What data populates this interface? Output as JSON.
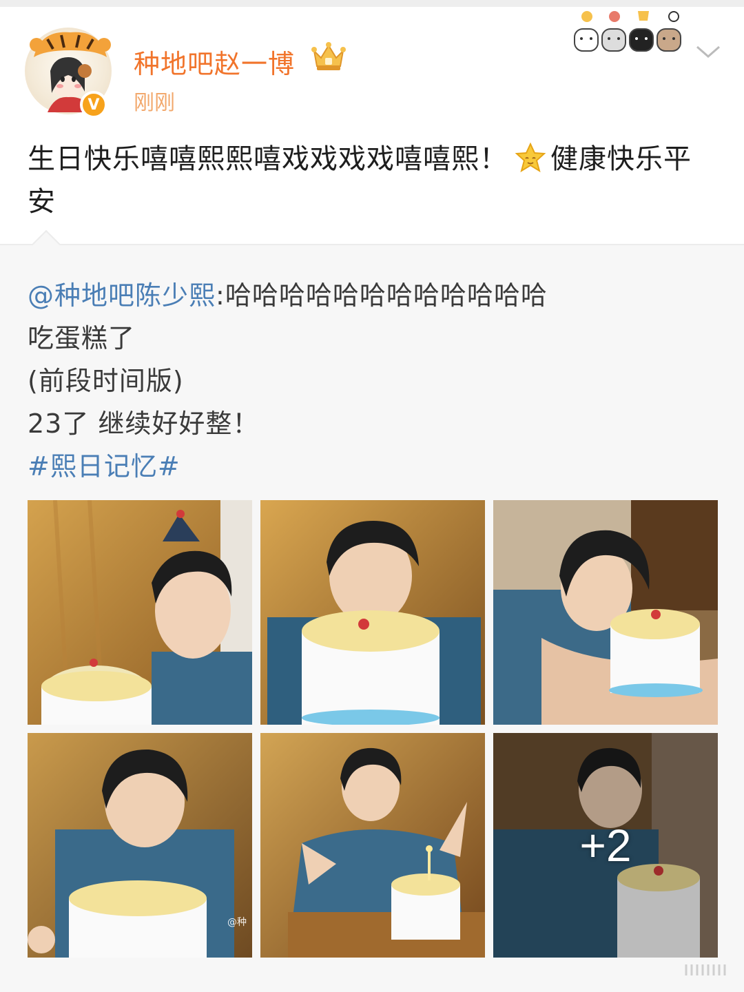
{
  "header": {
    "username": "种地吧赵一博",
    "timestamp": "刚刚",
    "verified_badge": "V"
  },
  "post": {
    "text_before_emoji": "生日快乐嘻嘻熙熙嘻戏戏戏戏嘻嘻熙！",
    "text_after_emoji": "健康快乐平安",
    "emoji": "star-smile-icon"
  },
  "repost": {
    "mention": "@种地吧陈少熙",
    "line1_text": ":哈哈哈哈哈哈哈哈哈哈哈哈",
    "line2": "吃蛋糕了",
    "line3": "(前段时间版)",
    "line4": "23了 继续好好整！",
    "hashtag": "#熙日记忆#",
    "more_count": "+2",
    "photo_watermark": "@种"
  },
  "colors": {
    "username": "#f1742b",
    "timestamp": "#f2a86c",
    "link": "#4a7eb5",
    "repost_bg": "#f7f7f7",
    "badge": "#f7a21b"
  }
}
